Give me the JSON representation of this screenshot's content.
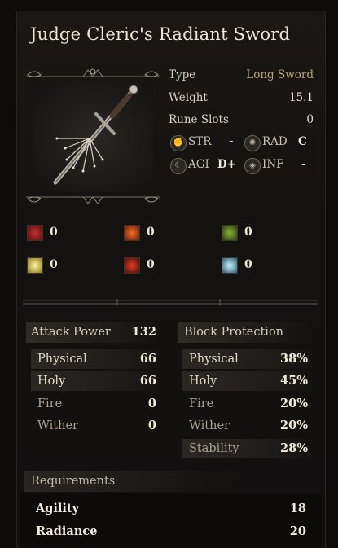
{
  "item": {
    "name": "Judge Cleric's Radiant Sword",
    "type_label": "Type",
    "type_value": "Long Sword",
    "weight_label": "Weight",
    "weight_value": "15.1",
    "rune_slots_label": "Rune Slots",
    "rune_slots_value": "0"
  },
  "scaling": [
    {
      "icon": "strength-icon",
      "label": "STR",
      "grade": "-"
    },
    {
      "icon": "radiance-icon",
      "label": "RAD",
      "grade": "C"
    },
    {
      "icon": "agility-icon",
      "label": "AGI",
      "grade": "D+"
    },
    {
      "icon": "influence-icon",
      "label": "INF",
      "grade": "-"
    }
  ],
  "effects": [
    {
      "icon": "bleed-icon",
      "value": "0",
      "color": "#8a1c1c"
    },
    {
      "icon": "fire-status-icon",
      "value": "0",
      "color": "#c2401a"
    },
    {
      "icon": "poison-icon",
      "value": "0",
      "color": "#5a7a1a"
    },
    {
      "icon": "holy-status-icon",
      "value": "0",
      "color": "#d6c23a"
    },
    {
      "icon": "blight-icon",
      "value": "0",
      "color": "#b0321a"
    },
    {
      "icon": "frost-icon",
      "value": "0",
      "color": "#5aa0b8"
    }
  ],
  "attack": {
    "header": "Attack Power",
    "total": "132",
    "rows": [
      {
        "label": "Physical",
        "value": "66"
      },
      {
        "label": "Holy",
        "value": "66"
      },
      {
        "label": "Fire",
        "value": "0"
      },
      {
        "label": "Wither",
        "value": "0"
      }
    ]
  },
  "block": {
    "header": "Block Protection",
    "rows": [
      {
        "label": "Physical",
        "value": "38%"
      },
      {
        "label": "Holy",
        "value": "45%"
      },
      {
        "label": "Fire",
        "value": "20%"
      },
      {
        "label": "Wither",
        "value": "20%"
      },
      {
        "label": "Stability",
        "value": "28%"
      }
    ]
  },
  "requirements": {
    "header": "Requirements",
    "rows": [
      {
        "label": "Agility",
        "value": "18"
      },
      {
        "label": "Radiance",
        "value": "20"
      }
    ]
  }
}
